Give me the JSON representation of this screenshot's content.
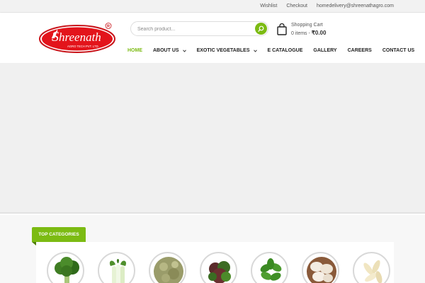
{
  "topbar": {
    "links": [
      "Wishlist",
      "Checkout",
      "homedelivery@shreenathagro.com"
    ]
  },
  "logo": {
    "name": "Shreenath",
    "tagline": "AGRO TECH PVT. LTD.",
    "mark": "R"
  },
  "search": {
    "placeholder": "Search product..."
  },
  "cart": {
    "title": "Shopping Cart",
    "items": "0 items",
    "separator": " - ",
    "total": "₹0.00"
  },
  "nav": {
    "items": [
      {
        "label": "HOME",
        "active": true
      },
      {
        "label": "ABOUT US",
        "dropdown": true
      },
      {
        "label": "EXOTIC VEGETABLES",
        "dropdown": true
      },
      {
        "label": "E CATALOGUE"
      },
      {
        "label": "GALLERY"
      },
      {
        "label": "CAREERS"
      },
      {
        "label": "CONTACT US"
      }
    ]
  },
  "categories": {
    "heading": "TOP CATEGORIES",
    "items": [
      {
        "icon": "broccoli-icon"
      },
      {
        "icon": "bok-choy-icon"
      },
      {
        "icon": "sprouts-icon"
      },
      {
        "icon": "lettuce-icon"
      },
      {
        "icon": "basil-icon"
      },
      {
        "icon": "mushroom-icon"
      },
      {
        "icon": "baby-corn-icon"
      }
    ]
  },
  "colors": {
    "accent": "#7cbb13",
    "logo_red": "#e3141b",
    "text_dark": "#222222",
    "hero_bg": "#f0f0f0"
  }
}
